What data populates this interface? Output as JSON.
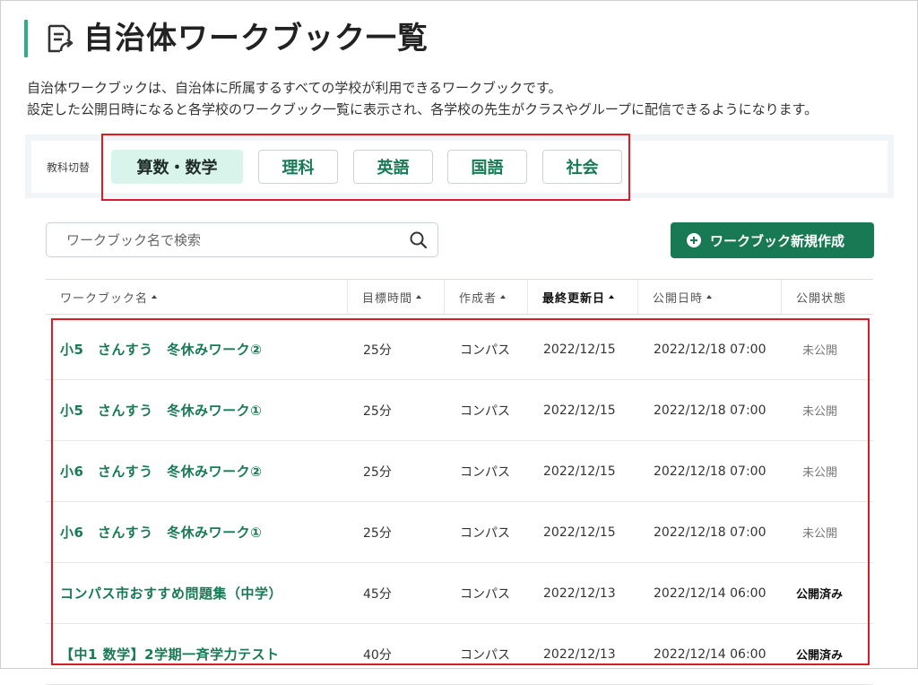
{
  "page": {
    "title": "自治体ワークブック一覧",
    "description_line1": "自治体ワークブックは、自治体に所属するすべての学校が利用できるワークブックです。",
    "description_line2": "設定した公開日時になると各学校のワークブック一覧に表示され、各学校の先生がクラスやグループに配信できるようになります。"
  },
  "subject_switcher": {
    "label": "教科切替",
    "tabs": [
      {
        "label": "算数・数学",
        "active": true
      },
      {
        "label": "理科",
        "active": false
      },
      {
        "label": "英語",
        "active": false
      },
      {
        "label": "国語",
        "active": false
      },
      {
        "label": "社会",
        "active": false
      }
    ]
  },
  "search": {
    "placeholder": "ワークブック名で検索",
    "icon": "search-icon"
  },
  "new_button": {
    "label": "ワークブック新規作成",
    "icon": "plus-circle-icon"
  },
  "table": {
    "columns": [
      {
        "label": "ワークブック名",
        "sortable": true
      },
      {
        "label": "目標時間",
        "sortable": true
      },
      {
        "label": "作成者",
        "sortable": true
      },
      {
        "label": "最終更新日",
        "sortable": true,
        "active": true
      },
      {
        "label": "公開日時",
        "sortable": true
      },
      {
        "label": "公開状態",
        "sortable": false
      }
    ],
    "rows": [
      {
        "name": "小5　さんすう　冬休みワーク②",
        "time": "25分",
        "author": "コンパス",
        "updated": "2022/12/15",
        "publish_at": "2022/12/18 07:00",
        "status": "未公開"
      },
      {
        "name": "小5　さんすう　冬休みワーク①",
        "time": "25分",
        "author": "コンパス",
        "updated": "2022/12/15",
        "publish_at": "2022/12/18 07:00",
        "status": "未公開"
      },
      {
        "name": "小6　さんすう　冬休みワーク②",
        "time": "25分",
        "author": "コンパス",
        "updated": "2022/12/15",
        "publish_at": "2022/12/18 07:00",
        "status": "未公開"
      },
      {
        "name": "小6　さんすう　冬休みワーク①",
        "time": "25分",
        "author": "コンパス",
        "updated": "2022/12/15",
        "publish_at": "2022/12/18 07:00",
        "status": "未公開"
      },
      {
        "name": "コンパス市おすすめ問題集（中学）",
        "time": "45分",
        "author": "コンパス",
        "updated": "2022/12/13",
        "publish_at": "2022/12/14 06:00",
        "status": "公開済み"
      },
      {
        "name": "【中1 数学】2学期一斉学力テスト",
        "time": "40分",
        "author": "コンパス",
        "updated": "2022/12/13",
        "publish_at": "2022/12/14 06:00",
        "status": "公開済み"
      }
    ]
  },
  "colors": {
    "brand_green": "#187a55",
    "title_accent": "#2eae86",
    "active_tab_bg": "#d9f4ea",
    "highlight_red": "#e01a22"
  }
}
